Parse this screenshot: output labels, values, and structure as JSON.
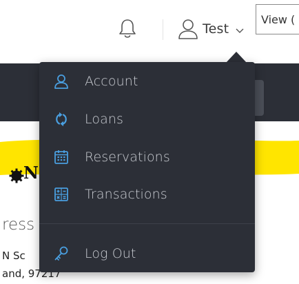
{
  "header": {
    "user_name": "Test",
    "view_button_label": "View (",
    "icons": {
      "notifications": "bell-icon",
      "user": "user-icon",
      "caret": "chevron-down-icon"
    }
  },
  "dropdown": {
    "items": [
      {
        "label": "Account",
        "icon": "user-icon"
      },
      {
        "label": "Loans",
        "icon": "refresh-icon"
      },
      {
        "label": "Reservations",
        "icon": "calendar-icon"
      },
      {
        "label": "Transactions",
        "icon": "calculator-icon"
      }
    ],
    "logout": {
      "label": "Log Out",
      "icon": "key-icon"
    }
  },
  "background_page": {
    "logo_letter": "N",
    "address_heading": "ress",
    "address_line1": "N Sc",
    "address_line2": "and, 97217"
  },
  "colors": {
    "dropdown_bg": "#2c2f37",
    "menu_icon": "#4a9fe0",
    "menu_text": "#c9ccd2",
    "highlight": "#ffe500",
    "header_text": "#3a3a3a"
  }
}
